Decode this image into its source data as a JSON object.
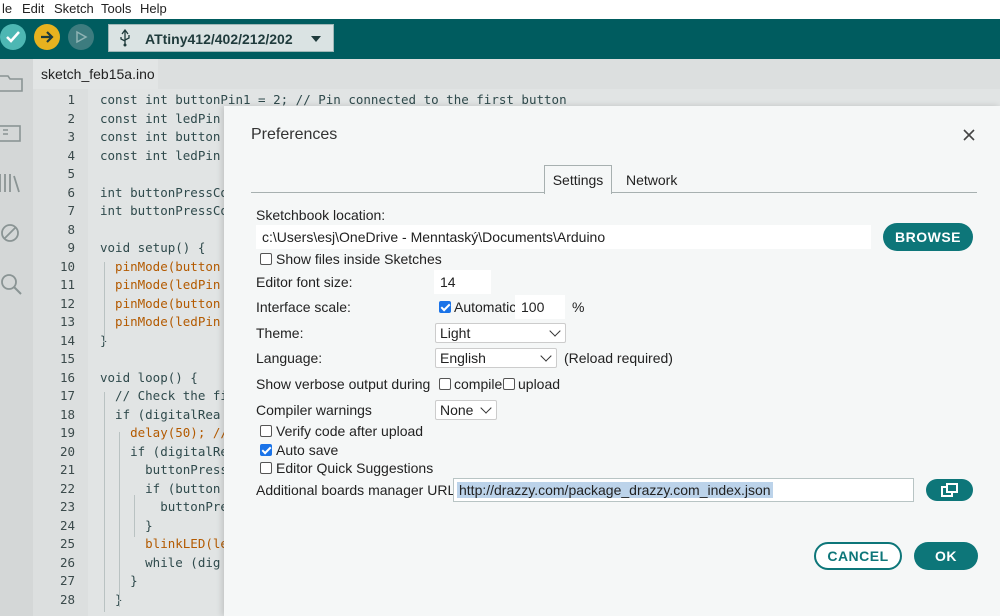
{
  "menu": [
    "le",
    "Edit",
    "Sketch",
    "Tools",
    "Help"
  ],
  "toolbar": {
    "board_name": "ATtiny412/402/212/202",
    "colors": {
      "bar": "#005c5f",
      "verify": "#4db7b3",
      "upload": "#e7b21f"
    }
  },
  "sketch_tab": "sketch_feb15a.ino",
  "code": {
    "line_numbers": [
      "1",
      "2",
      "3",
      "4",
      "5",
      "6",
      "7",
      "8",
      "9",
      "10",
      "11",
      "12",
      "13",
      "14",
      "15",
      "16",
      "17",
      "18",
      "19",
      "20",
      "21",
      "22",
      "23",
      "24",
      "25",
      "26",
      "27",
      "28"
    ],
    "lines": [
      "const int buttonPin1 = 2; // Pin connected to the first button",
      "const int ledPin",
      "const int button",
      "const int ledPin",
      "",
      "int buttonPressCo",
      "int buttonPressCo",
      "",
      "void setup() {",
      "  pinMode(button",
      "  pinMode(ledPin",
      "  pinMode(button",
      "  pinMode(ledPin",
      "}",
      "",
      "void loop() {",
      "  // Check the fi",
      "  if (digitalRea",
      "    delay(50); //",
      "    if (digitalRe",
      "      buttonPress",
      "      if (button",
      "        buttonPre",
      "      }",
      "      blinkLED(le",
      "      while (dig",
      "    }",
      "  }"
    ]
  },
  "dialog": {
    "title": "Preferences",
    "tabs": {
      "settings": "Settings",
      "network": "Network"
    },
    "sketchbook_label": "Sketchbook location:",
    "sketchbook_path": "c:\\Users\\esj\\OneDrive - Menntaský\\Documents\\Arduino",
    "browse": "BROWSE",
    "show_files": "Show files inside Sketches",
    "font_size_label": "Editor font size:",
    "font_size": "14",
    "scale_label": "Interface scale:",
    "scale_auto": "Automatic",
    "scale_value": "100",
    "scale_unit": "%",
    "theme_label": "Theme:",
    "theme": "Light",
    "language_label": "Language:",
    "language": "English",
    "reload_note": "(Reload required)",
    "verbose_label": "Show verbose output during",
    "compile": "compile",
    "upload": "upload",
    "warnings_label": "Compiler warnings",
    "warnings": "None",
    "verify_after": "Verify code after upload",
    "autosave": "Auto save",
    "quick_suggestions": "Editor Quick Suggestions",
    "boards_label": "Additional boards manager URLs:",
    "boards_url": "http://drazzy.com/package_drazzy.com_index.json",
    "cancel": "CANCEL",
    "ok": "OK",
    "accent": "#0d7679"
  }
}
